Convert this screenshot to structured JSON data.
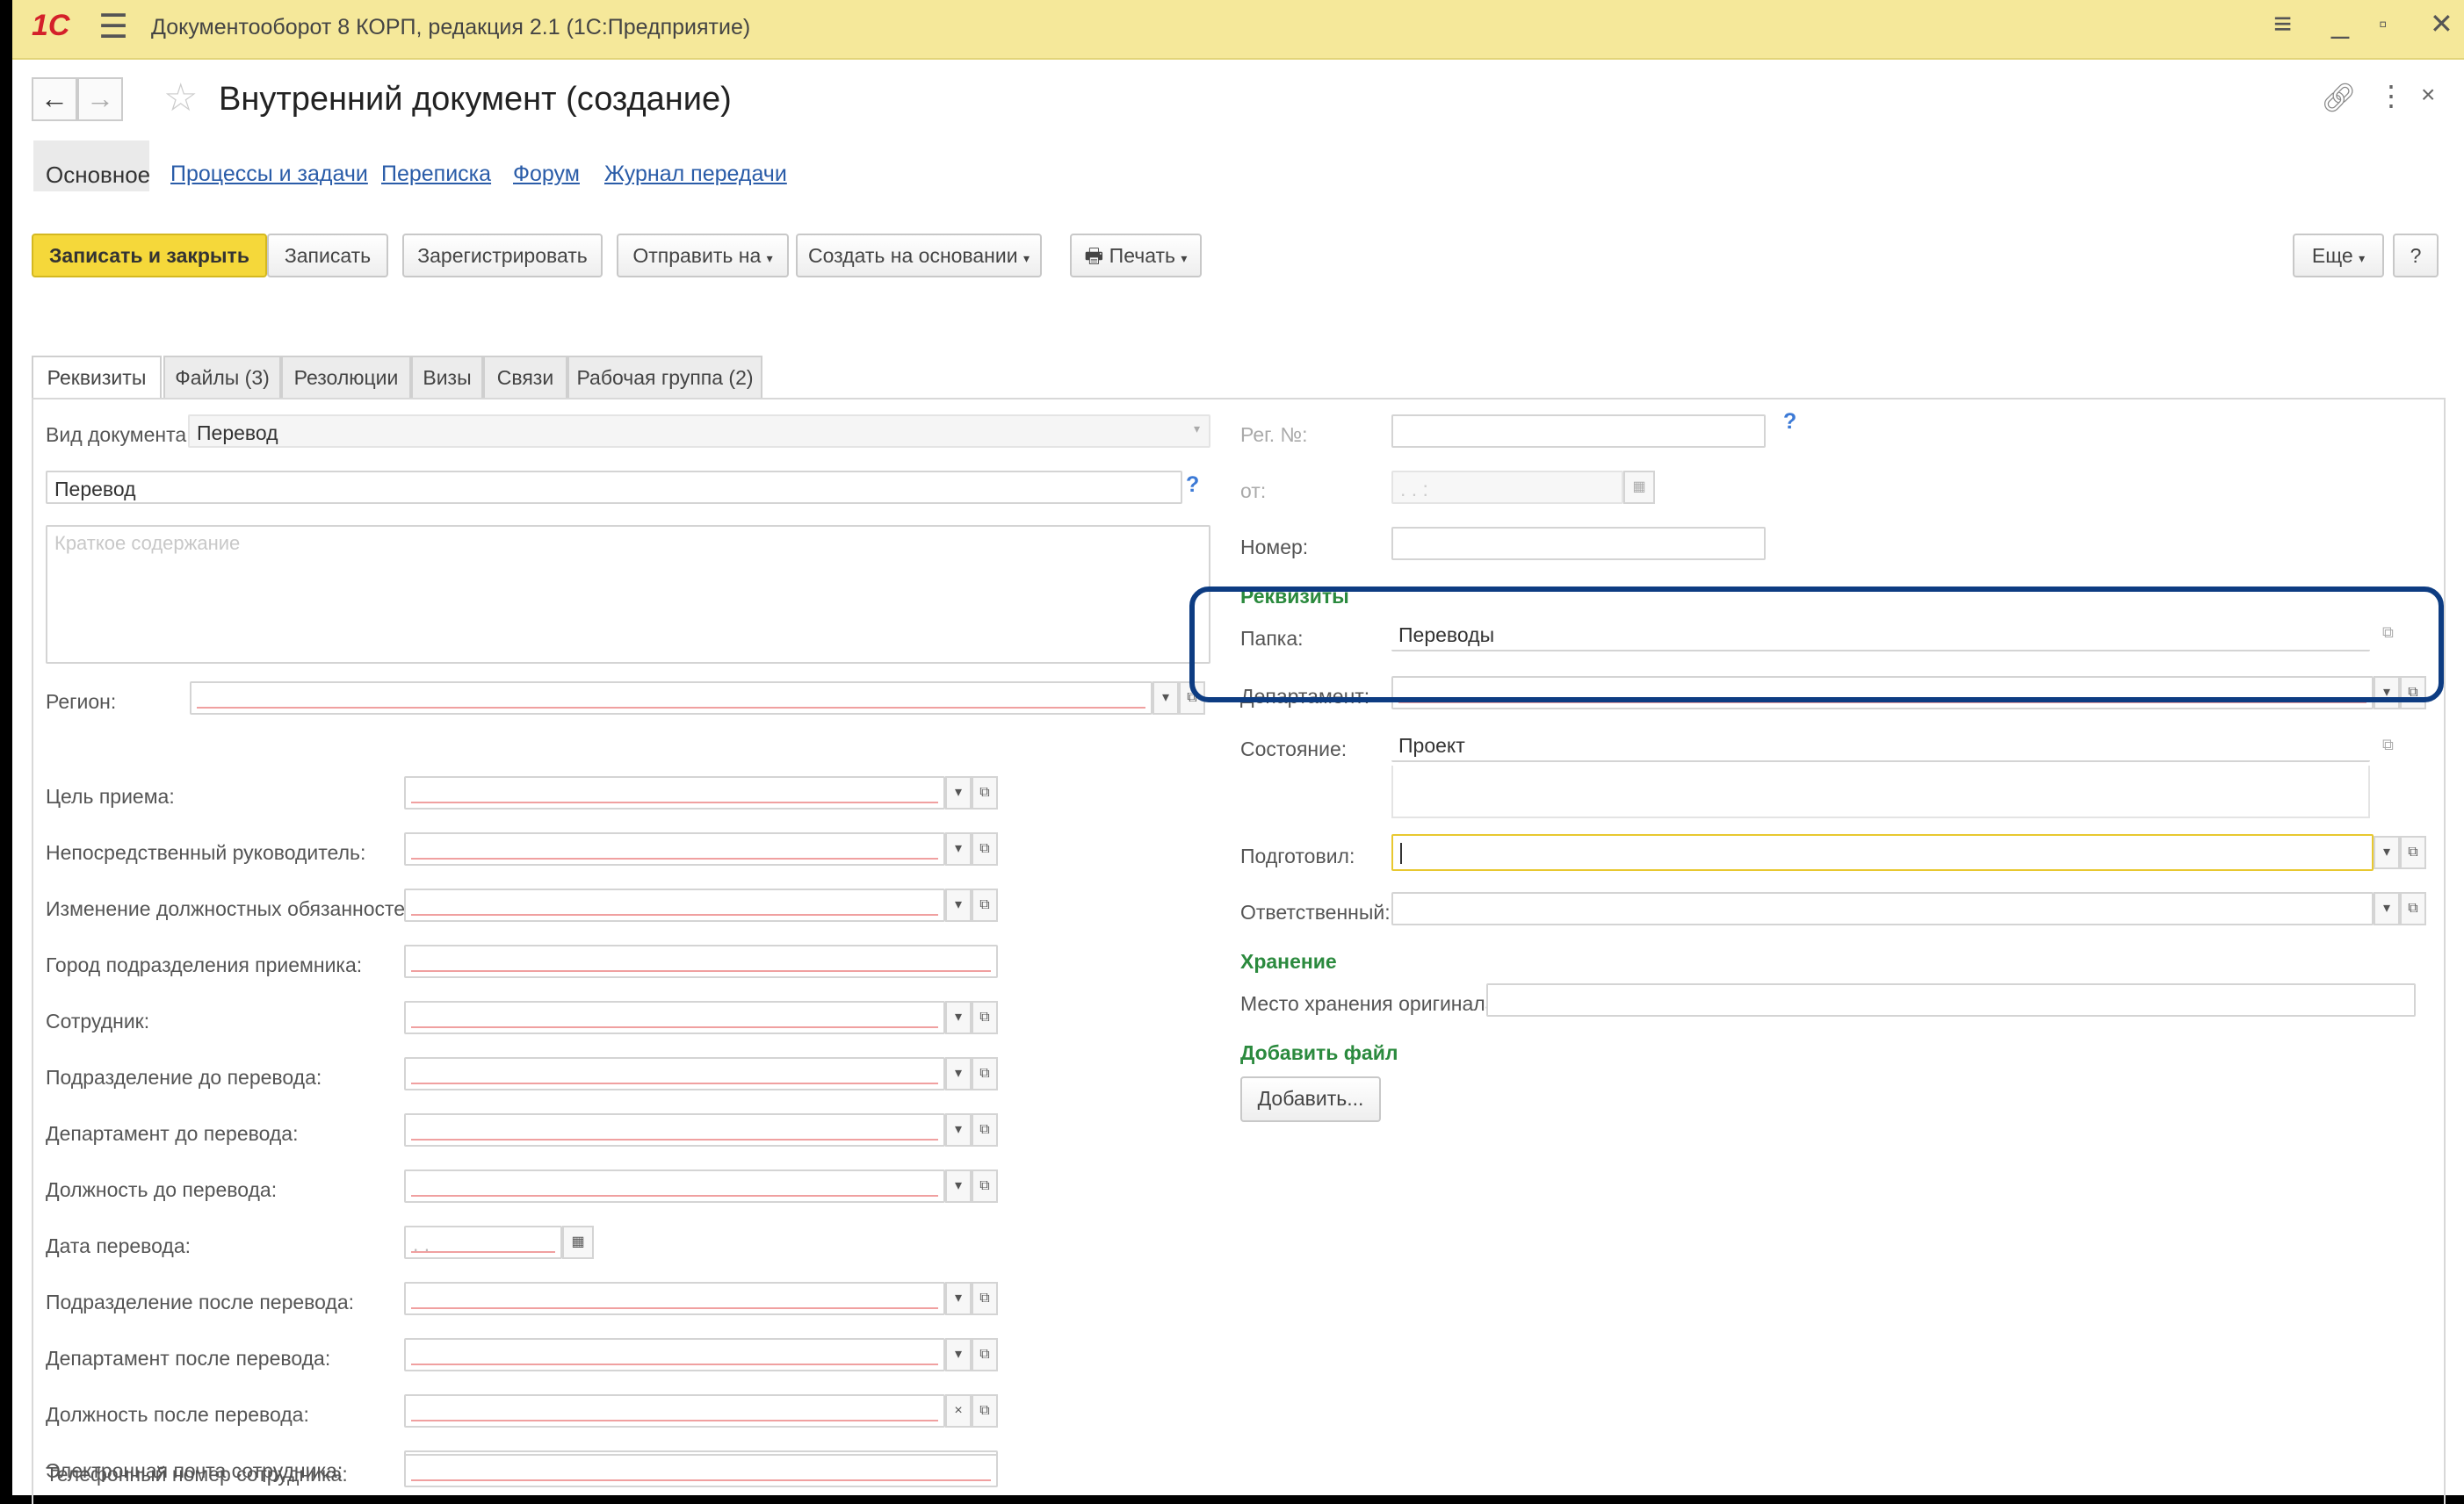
{
  "window": {
    "title": "Документооборот 8 КОРП, редакция 2.1  (1С:Предприятие)",
    "logo": "1С"
  },
  "document": {
    "title": "Внутренний документ (создание)"
  },
  "nav_tabs": [
    "Основное",
    "Процессы и задачи",
    "Переписка",
    "Форум",
    "Журнал передачи"
  ],
  "toolbar": {
    "save_close": "Записать и закрыть",
    "save": "Записать",
    "register": "Зарегистрировать",
    "send": "Отправить на",
    "create_based": "Создать на основании",
    "print": "Печать",
    "more": "Еще",
    "help": "?"
  },
  "form_tabs": [
    "Реквизиты",
    "Файлы (3)",
    "Резолюции",
    "Визы",
    "Связи",
    "Рабочая группа (2)"
  ],
  "left": {
    "doc_type_label": "Вид документа:",
    "doc_type_value": "Перевод",
    "subject_value": "Перевод",
    "summary_placeholder": "Краткое содержание",
    "region_label": "Регион:",
    "fields": [
      "Цель приема:",
      "Непосредственный руководитель:",
      "Изменение должностных обязанностей:",
      "Город подразделения приемника:",
      "Сотрудник:",
      "Подразделение до перевода:",
      "Департамент до перевода:",
      "Должность до перевода:",
      "Дата перевода:",
      "Подразделение после перевода:",
      "Департамент после перевода:",
      "Должность после перевода:",
      "Электронная почта сотрудника:",
      "Телефонный номер сотрудника:"
    ],
    "date_placeholder": ". ."
  },
  "right": {
    "reg_no_label": "Рег. №:",
    "from_label": "от:",
    "from_placeholder": ". .   :",
    "number_label": "Номер:",
    "section_requisites": "Реквизиты",
    "folder_label": "Папка:",
    "folder_value": "Переводы",
    "department_label": "Департамент:",
    "state_label": "Состояние:",
    "state_value": "Проект",
    "prepared_label": "Подготовил:",
    "responsible_label": "Ответственный:",
    "section_storage": "Хранение",
    "storage_label": "Место хранения оригинала:",
    "section_add_file": "Добавить файл",
    "add_button": "Добавить..."
  },
  "colors": {
    "titlebar": "#f5e89a",
    "primary_button": "#f5d83a",
    "highlight": "#0d3c82",
    "section": "#2b8a3e"
  }
}
